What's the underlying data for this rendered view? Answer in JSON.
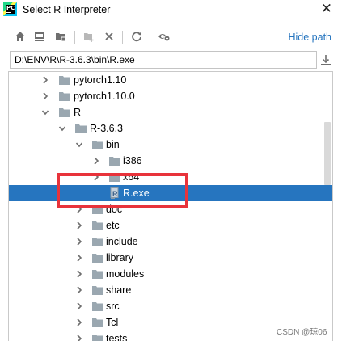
{
  "window": {
    "app_icon": "pycharm-icon",
    "title": "Select R Interpreter",
    "close_icon": "close-icon"
  },
  "toolbar": {
    "buttons": [
      "home-icon",
      "desktop-icon",
      "project-folder-icon",
      "new-folder-icon",
      "delete-icon",
      "refresh-icon",
      "show-hidden-icon"
    ],
    "hide_path_label": "Hide path"
  },
  "path": {
    "value": "D:\\ENV\\R\\R-3.6.3\\bin\\R.exe",
    "download_icon": "download-icon"
  },
  "tree": {
    "rows": [
      {
        "label": "pytorch1.10",
        "expanded": false,
        "type": "folder"
      },
      {
        "label": "pytorch1.10.0",
        "expanded": false,
        "type": "folder"
      },
      {
        "label": "R",
        "expanded": true,
        "type": "folder"
      },
      {
        "label": "R-3.6.3",
        "expanded": true,
        "type": "folder"
      },
      {
        "label": "bin",
        "expanded": true,
        "type": "folder"
      },
      {
        "label": "i386",
        "expanded": false,
        "type": "folder"
      },
      {
        "label": "x64",
        "expanded": false,
        "type": "folder"
      },
      {
        "label": "R.exe",
        "type": "file",
        "selected": true
      },
      {
        "label": "doc",
        "expanded": false,
        "type": "folder"
      },
      {
        "label": "etc",
        "expanded": false,
        "type": "folder"
      },
      {
        "label": "include",
        "expanded": false,
        "type": "folder"
      },
      {
        "label": "library",
        "expanded": false,
        "type": "folder"
      },
      {
        "label": "modules",
        "expanded": false,
        "type": "folder"
      },
      {
        "label": "share",
        "expanded": false,
        "type": "folder"
      },
      {
        "label": "src",
        "expanded": false,
        "type": "folder"
      },
      {
        "label": "Tcl",
        "expanded": false,
        "type": "folder"
      },
      {
        "label": "tests",
        "expanded": false,
        "type": "folder"
      }
    ]
  },
  "colors": {
    "selection": "#2675bf",
    "link": "#2675bf",
    "annotation_box": "#e8333b",
    "folder_icon": "#9aa7b0"
  },
  "watermark": "CSDN @琼06"
}
